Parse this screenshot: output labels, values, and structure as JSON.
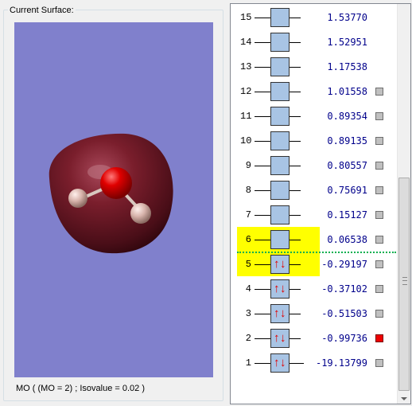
{
  "surface_panel": {
    "title": "Current Surface:",
    "status": "MO ( (MO = 2) ; Isovalue = 0.02 )",
    "background_color": "#8080cc",
    "molecule": "water",
    "atoms": [
      "O",
      "H",
      "H"
    ]
  },
  "mo_diagram": {
    "highlight_color": "#ffff00",
    "active_color": "#ee0000",
    "orbitals": [
      {
        "number": "15",
        "energy": "1.53770",
        "occupied": false,
        "highlighted": false,
        "has_checkbox": false,
        "active": false
      },
      {
        "number": "14",
        "energy": "1.52951",
        "occupied": false,
        "highlighted": false,
        "has_checkbox": false,
        "active": false
      },
      {
        "number": "13",
        "energy": "1.17538",
        "occupied": false,
        "highlighted": false,
        "has_checkbox": false,
        "active": false
      },
      {
        "number": "12",
        "energy": "1.01558",
        "occupied": false,
        "highlighted": false,
        "has_checkbox": true,
        "active": false
      },
      {
        "number": "11",
        "energy": "0.89354",
        "occupied": false,
        "highlighted": false,
        "has_checkbox": true,
        "active": false
      },
      {
        "number": "10",
        "energy": "0.89135",
        "occupied": false,
        "highlighted": false,
        "has_checkbox": true,
        "active": false
      },
      {
        "number": "9",
        "energy": "0.80557",
        "occupied": false,
        "highlighted": false,
        "has_checkbox": true,
        "active": false
      },
      {
        "number": "8",
        "energy": "0.75691",
        "occupied": false,
        "highlighted": false,
        "has_checkbox": true,
        "active": false
      },
      {
        "number": "7",
        "energy": "0.15127",
        "occupied": false,
        "highlighted": false,
        "has_checkbox": true,
        "active": false
      },
      {
        "number": "6",
        "energy": "0.06538",
        "occupied": false,
        "highlighted": true,
        "has_checkbox": true,
        "active": false
      },
      {
        "number": "5",
        "energy": "-0.29197",
        "occupied": true,
        "highlighted": true,
        "has_checkbox": true,
        "active": false
      },
      {
        "number": "4",
        "energy": "-0.37102",
        "occupied": true,
        "highlighted": false,
        "has_checkbox": true,
        "active": false
      },
      {
        "number": "3",
        "energy": "-0.51503",
        "occupied": true,
        "highlighted": false,
        "has_checkbox": true,
        "active": false
      },
      {
        "number": "2",
        "energy": "-0.99736",
        "occupied": true,
        "highlighted": false,
        "has_checkbox": true,
        "active": true
      },
      {
        "number": "1",
        "energy": "-19.13799",
        "occupied": true,
        "highlighted": false,
        "has_checkbox": true,
        "active": false
      }
    ]
  }
}
